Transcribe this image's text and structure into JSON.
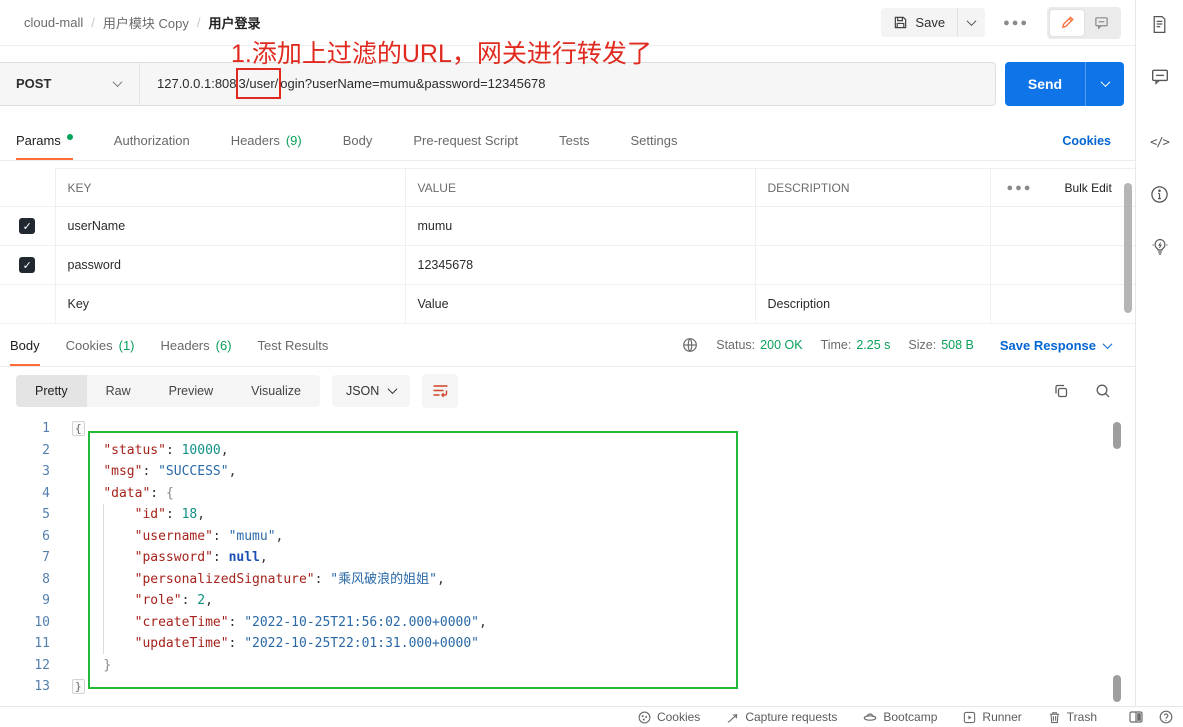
{
  "header": {
    "breadcrumb": {
      "collection": "cloud-mall",
      "folder": "用户模块 Copy",
      "request": "用户登录"
    },
    "save_label": "Save",
    "annotation": "1.添加上过滤的URL，网关进行转发了"
  },
  "request": {
    "method": "POST",
    "url": {
      "before": "127.0.0.1:808",
      "boxed": "3/user/",
      "after": "ogin?userName=mumu&password=12345678"
    },
    "send_label": "Send",
    "tabs": [
      {
        "label": "Params"
      },
      {
        "label": "Authorization"
      },
      {
        "label": "Headers",
        "count": "(9)"
      },
      {
        "label": "Body"
      },
      {
        "label": "Pre-request Script"
      },
      {
        "label": "Tests"
      },
      {
        "label": "Settings"
      }
    ],
    "cookies_link": "Cookies"
  },
  "params": {
    "col_key": "KEY",
    "col_value": "VALUE",
    "col_description": "DESCRIPTION",
    "bulk_edit": "Bulk Edit",
    "rows": [
      {
        "key": "userName",
        "value": "mumu",
        "checked": true
      },
      {
        "key": "password",
        "value": "12345678",
        "checked": true
      }
    ],
    "placeholder": {
      "key": "Key",
      "value": "Value",
      "description": "Description"
    }
  },
  "response": {
    "tabs": [
      {
        "label": "Body"
      },
      {
        "label": "Cookies",
        "count": "(1)"
      },
      {
        "label": "Headers",
        "count": "(6)"
      },
      {
        "label": "Test Results"
      }
    ],
    "status_label": "Status:",
    "status_value": "200 OK",
    "time_label": "Time:",
    "time_value": "2.25 s",
    "size_label": "Size:",
    "size_value": "508 B",
    "save_response_label": "Save Response",
    "view_tabs": [
      "Pretty",
      "Raw",
      "Preview",
      "Visualize"
    ],
    "language": "JSON"
  },
  "code": {
    "lines": [
      [
        [
          "w",
          "{"
        ]
      ],
      [
        [
          "i",
          "    "
        ],
        [
          "k",
          "\"status\""
        ],
        [
          "d",
          ": "
        ],
        [
          "n",
          "10000"
        ],
        [
          "d",
          ","
        ]
      ],
      [
        [
          "i",
          "    "
        ],
        [
          "k",
          "\"msg\""
        ],
        [
          "d",
          ": "
        ],
        [
          "s",
          "\"SUCCESS\""
        ],
        [
          "d",
          ","
        ]
      ],
      [
        [
          "i",
          "    "
        ],
        [
          "k",
          "\"data\""
        ],
        [
          "d",
          ": "
        ],
        [
          "b",
          "{"
        ]
      ],
      [
        [
          "i",
          "        "
        ],
        [
          "k",
          "\"id\""
        ],
        [
          "d",
          ": "
        ],
        [
          "n",
          "18"
        ],
        [
          "d",
          ","
        ]
      ],
      [
        [
          "i",
          "        "
        ],
        [
          "k",
          "\"username\""
        ],
        [
          "d",
          ": "
        ],
        [
          "s",
          "\"mumu\""
        ],
        [
          "d",
          ","
        ]
      ],
      [
        [
          "i",
          "        "
        ],
        [
          "k",
          "\"password\""
        ],
        [
          "d",
          ": "
        ],
        [
          "a",
          "null"
        ],
        [
          "d",
          ","
        ]
      ],
      [
        [
          "i",
          "        "
        ],
        [
          "k",
          "\"personalizedSignature\""
        ],
        [
          "d",
          ": "
        ],
        [
          "s",
          "\"乘风破浪的姐姐\""
        ],
        [
          "d",
          ","
        ]
      ],
      [
        [
          "i",
          "        "
        ],
        [
          "k",
          "\"role\""
        ],
        [
          "d",
          ": "
        ],
        [
          "n",
          "2"
        ],
        [
          "d",
          ","
        ]
      ],
      [
        [
          "i",
          "        "
        ],
        [
          "k",
          "\"createTime\""
        ],
        [
          "d",
          ": "
        ],
        [
          "s",
          "\"2022-10-25T21:56:02.000+0000\""
        ],
        [
          "d",
          ","
        ]
      ],
      [
        [
          "i",
          "        "
        ],
        [
          "k",
          "\"updateTime\""
        ],
        [
          "d",
          ": "
        ],
        [
          "s",
          "\"2022-10-25T22:01:31.000+0000\""
        ]
      ],
      [
        [
          "i",
          "    "
        ],
        [
          "b",
          "}"
        ]
      ],
      [
        [
          "w",
          "}"
        ]
      ]
    ]
  },
  "footer": {
    "items": [
      "Cookies",
      "Capture requests",
      "Bootcamp",
      "Runner",
      "Trash"
    ]
  },
  "colors": {
    "accent_orange": "#FF6C37",
    "link_blue": "#0265D2",
    "send_blue": "#0E74E8",
    "success_green": "#0BA05A",
    "annotation_red": "#E12A1F",
    "response_box_green": "#23B83A"
  }
}
